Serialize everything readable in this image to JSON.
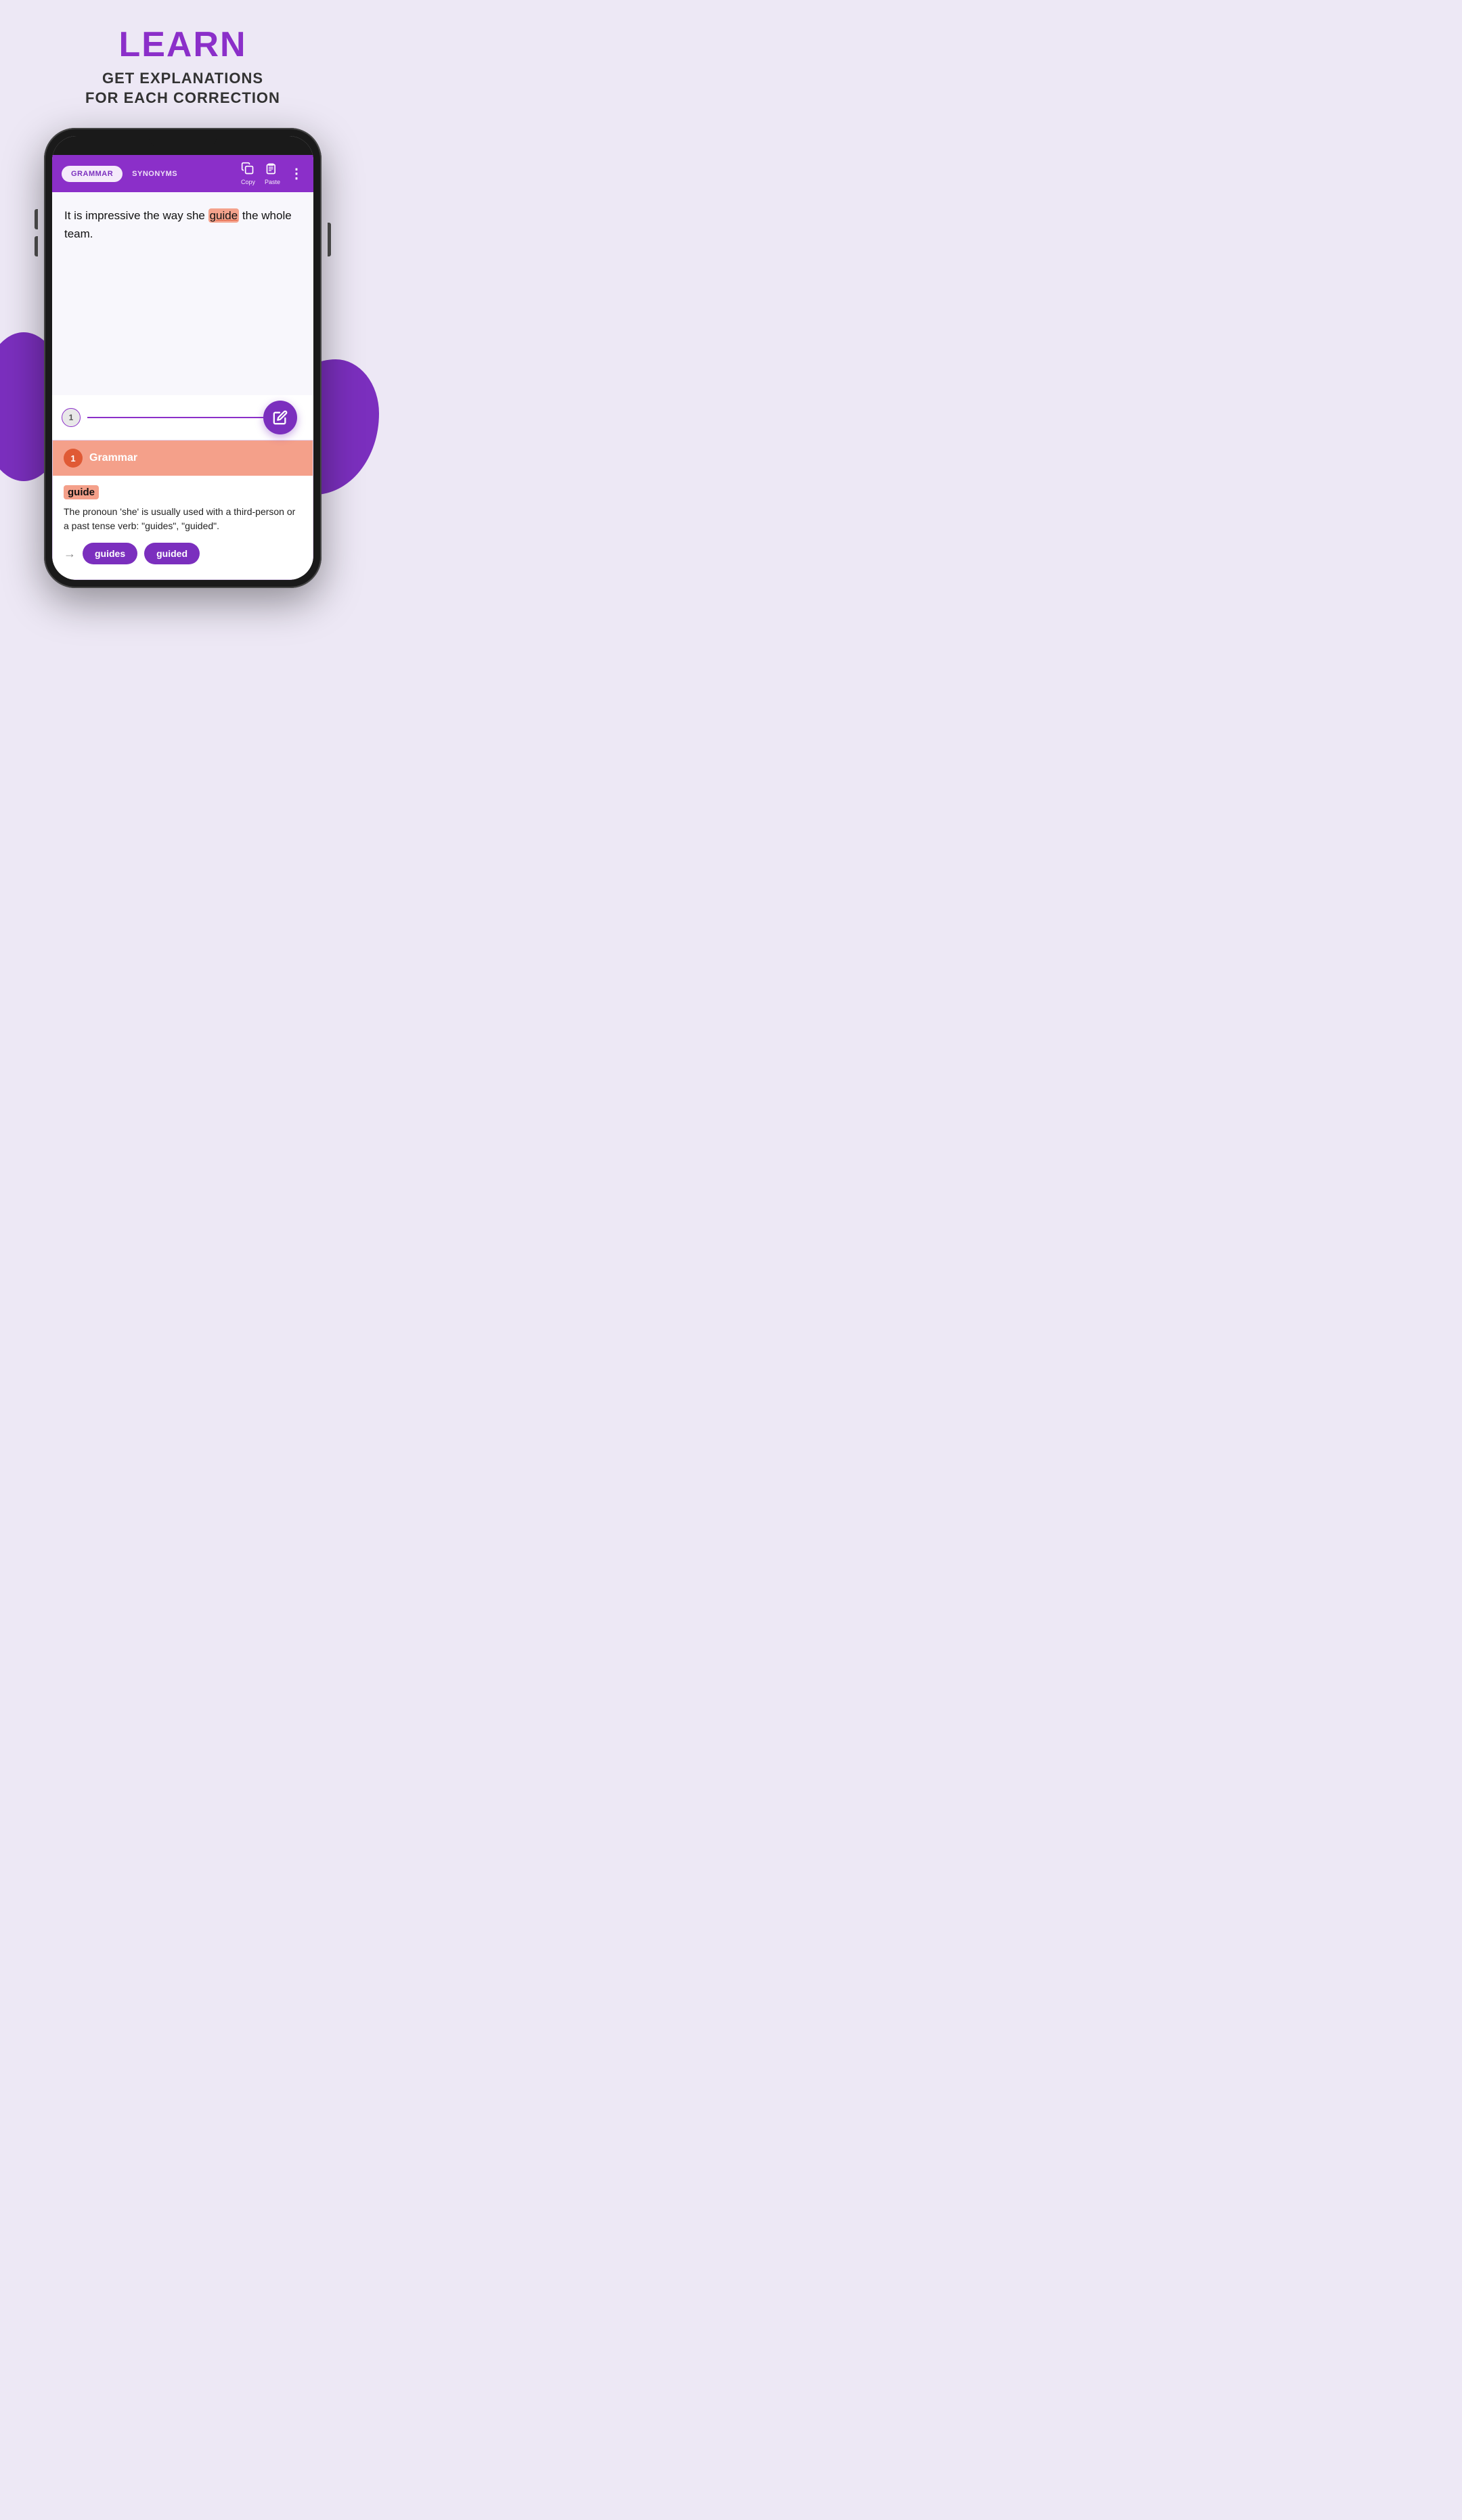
{
  "header": {
    "title": "LEARN",
    "subtitle_line1": "GET EXPLANATIONS",
    "subtitle_line2": "FOR EACH CORRECTION"
  },
  "app": {
    "tabs": [
      {
        "id": "grammar",
        "label": "GRAMMAR",
        "active": true
      },
      {
        "id": "synonyms",
        "label": "SYNONYMS",
        "active": false
      }
    ],
    "toolbar": {
      "copy_label": "Copy",
      "paste_label": "Paste",
      "more_label": "⋮"
    },
    "text_content": {
      "before_highlight": "It is impressive the way she ",
      "highlighted_word": "guide",
      "after_highlight": " the whole team."
    },
    "correction_number": "1",
    "edit_icon": "✎",
    "grammar_section": {
      "badge": "1",
      "title": "Grammar",
      "error_word": "guide",
      "explanation": "The pronoun 'she' is usually used with a third-person or a past tense verb: \"guides\", \"guided\".",
      "arrow": "→",
      "suggestions": [
        "guides",
        "guided"
      ]
    }
  },
  "colors": {
    "purple_brand": "#8b2fc9",
    "purple_dark": "#7b2fbe",
    "bg_light": "#ede8f5",
    "error_highlight": "#f4a28c",
    "grammar_header_bg": "#f4a08a",
    "badge_red": "#e05a35"
  }
}
